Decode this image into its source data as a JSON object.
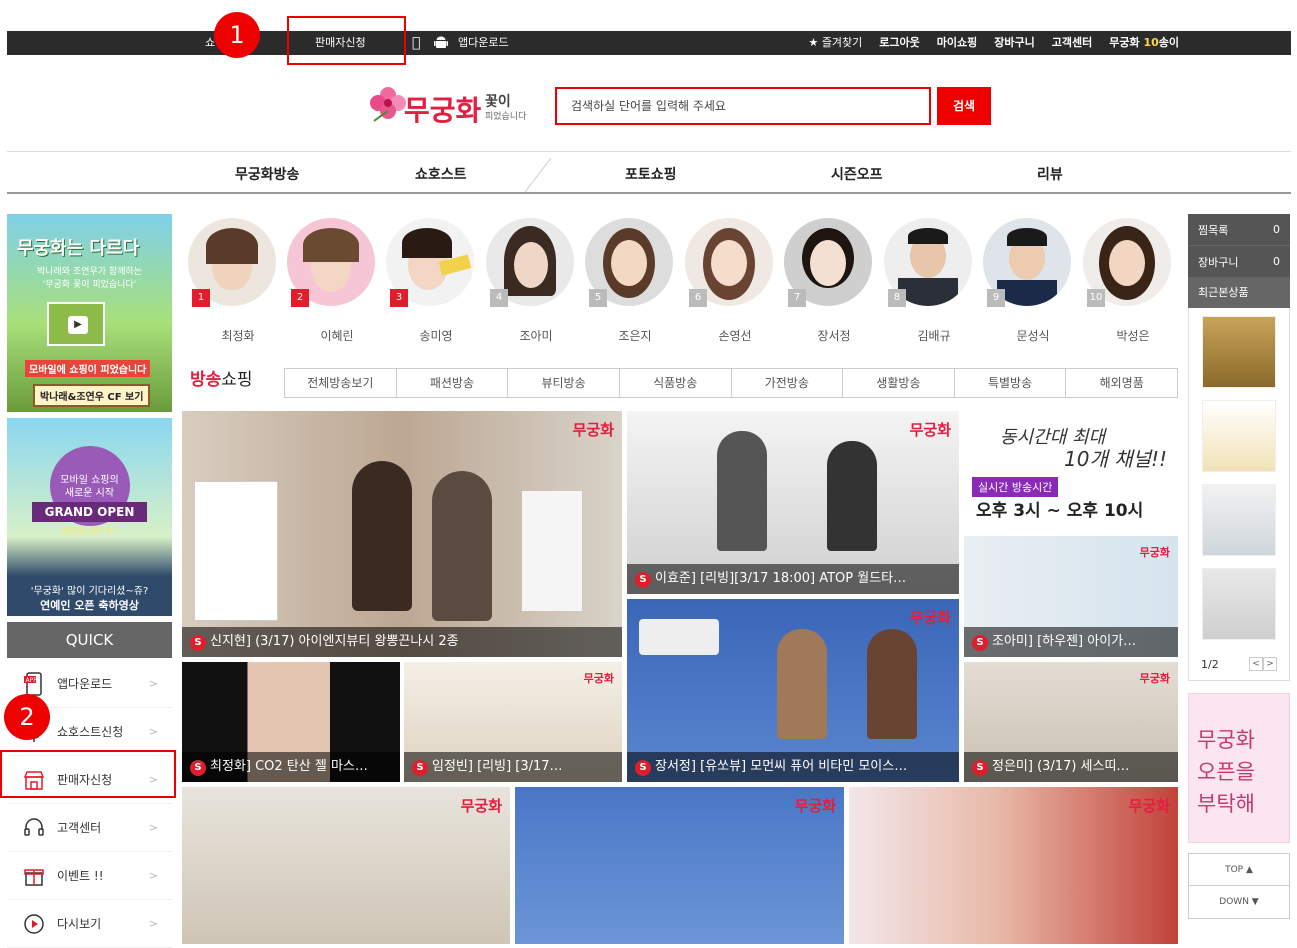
{
  "topbar": {
    "seller_apply": "판매자신청",
    "app_download": "앱다운로드",
    "links": [
      "즐겨찾기",
      "로그아웃",
      "마이쇼핑",
      "장바구니",
      "고객센터"
    ],
    "honey_prefix": "무궁화 ",
    "honey_count": "10",
    "honey_suffix": "송이"
  },
  "callouts": {
    "one": "1",
    "two": "2"
  },
  "logo": {
    "word": "무궁화",
    "sub1": "꽃이",
    "sub2": "피었습니다"
  },
  "search": {
    "placeholder": "검색하실 단어를 입력해 주세요",
    "button": "검색"
  },
  "gnb": [
    "무궁화방송",
    "쇼호스트",
    "포토쇼핑",
    "시즌오프",
    "리뷰"
  ],
  "left_banners": {
    "banner1": {
      "title": "무궁화는 다르다",
      "desc1": "박나래와 조연우가 함께하는",
      "desc2": "'무궁화 꽃이 피었습니다'",
      "tag": "모바일에 쇼핑이 피었습니다",
      "cta": "박나래&조연우 CF 보기"
    },
    "banner2": {
      "line1": "모바일 쇼핑의",
      "line2": "새로운 시작",
      "grand": "GRAND OPEN",
      "date": "2016.02.17",
      "line3": "'무궁화' 많이 기다리셨~쥬?",
      "line4": "연예인 오픈 축하영상"
    }
  },
  "quick": {
    "title": "QUICK",
    "items": [
      {
        "label": "앱다운로드",
        "icon": "app-icon"
      },
      {
        "label": "쇼호스트신청",
        "icon": "mic-icon"
      },
      {
        "label": "판매자신청",
        "icon": "shop-icon"
      },
      {
        "label": "고객센터",
        "icon": "headset-icon"
      },
      {
        "label": "이벤트 !!",
        "icon": "gift-icon"
      },
      {
        "label": "다시보기",
        "icon": "play-icon"
      }
    ]
  },
  "hosts": [
    {
      "rank": "1",
      "name": "최정화"
    },
    {
      "rank": "2",
      "name": "이혜린"
    },
    {
      "rank": "3",
      "name": "송미영"
    },
    {
      "rank": "4",
      "name": "조아미"
    },
    {
      "rank": "5",
      "name": "조은지"
    },
    {
      "rank": "6",
      "name": "손영선"
    },
    {
      "rank": "7",
      "name": "장서정"
    },
    {
      "rank": "8",
      "name": "김배규"
    },
    {
      "rank": "9",
      "name": "문성식"
    },
    {
      "rank": "10",
      "name": "박성은"
    }
  ],
  "section": {
    "title_red": "방송",
    "title_dark": "쇼핑"
  },
  "categories": [
    "전체방송보기",
    "패션방송",
    "뷰티방송",
    "식품방송",
    "가전방송",
    "생활방송",
    "특별방송",
    "해외명품"
  ],
  "tiles": {
    "t1": "신지현] (3/17) 아이엔지뷰티 왕뽕끈나시 2종",
    "t2": "이효준] [리빙][3/17 18:00] ATOP 월드타…",
    "t3": "장서정] [유쏘뷰] 모먼씨 퓨어 비타민 모이스…",
    "t4": "최정화] CO2 탄산 젤 마스…",
    "t5": "임정빈] [리빙] [3/17…",
    "t6": "조아미] [하우젠] 아이가…",
    "t7": "정은미] (3/17) 세스띠…",
    "brand": "무궁화",
    "s_mark": "S"
  },
  "promo": {
    "line1": "동시간대 최대",
    "line2": "10개 채널!!",
    "tag": "실시간 방송시간",
    "time": "오후 3시 ~ 오후 10시"
  },
  "right_panel": {
    "wishlist_label": "찜목록",
    "wishlist_count": "0",
    "cart_label": "장바구니",
    "cart_count": "0",
    "recent_label": "최근본상품",
    "pager": "1/2",
    "ad_lines": [
      "무궁화",
      "오픈을",
      "부탁해"
    ],
    "top_label": "TOP ▲",
    "down_label": "DOWN ▼"
  },
  "colors": {
    "accent": "#e41e3f",
    "callout": "#ee0000",
    "topbar": "#2b2b2b"
  }
}
